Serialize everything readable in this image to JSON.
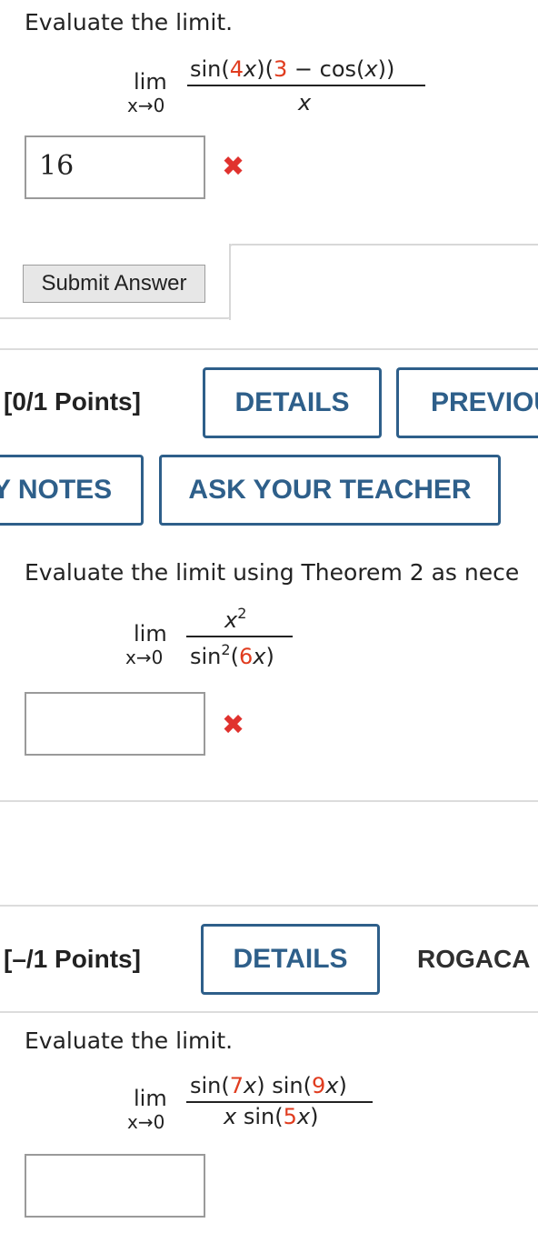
{
  "q1": {
    "prompt": "Evaluate the limit.",
    "lim": "lim",
    "sub": "x→0",
    "answer_value": "16",
    "status": "✖",
    "submit_label": "Submit Answer"
  },
  "q2": {
    "points": "[0/1 Points]",
    "details_label": "DETAILS",
    "previous_label": "PREVIOU",
    "notes_label": "NOTES",
    "ask_label": "ASK YOUR TEACHER",
    "prompt": "Evaluate the limit using Theorem 2 as nece",
    "lim": "lim",
    "sub": "x→0",
    "answer_value": "",
    "status": "✖"
  },
  "q3": {
    "points": "[–/1 Points]",
    "details_label": "DETAILS",
    "source_label": "ROGACA",
    "prompt": "Evaluate the limit.",
    "lim": "lim",
    "sub": "x→0",
    "answer_value": ""
  },
  "colors": {
    "button_border": "#2e5f8a",
    "error_red": "#e0322e",
    "highlight_red": "#e03c1f"
  }
}
